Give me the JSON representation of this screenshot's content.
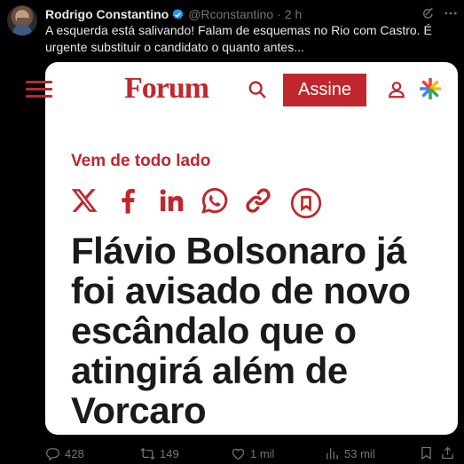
{
  "tweet": {
    "author_name": "Rodrigo Constantino",
    "handle": "@Rconstantino",
    "separator": "·",
    "time": "2 h",
    "text": "A esquerda está salivando! Falam de esquemas no Rio com Castro. É urgente substituir o candidato o quanto antes..."
  },
  "card": {
    "logo": "Forum",
    "subscribe_label": "Assine",
    "section": "Vem de todo lado",
    "headline": "Flávio Bolsonaro já foi avisado de novo escândalo que o atingirá além de Vorcaro"
  },
  "actions": {
    "replies": "428",
    "reposts": "149",
    "likes": "1 mil",
    "views": "53 mil"
  },
  "colors": {
    "brand_red": "#c0272d",
    "verified_blue": "#1d9bf0",
    "muted": "#71767b"
  },
  "icons": [
    "verified-badge-icon",
    "grok-icon",
    "more-icon",
    "menu-icon",
    "search-icon",
    "user-icon",
    "google-star-icon",
    "x-share-icon",
    "facebook-share-icon",
    "linkedin-share-icon",
    "whatsapp-share-icon",
    "link-share-icon",
    "bookmark-share-icon",
    "reply-icon",
    "repost-icon",
    "like-icon",
    "views-icon",
    "bookmark-icon",
    "share-icon"
  ]
}
